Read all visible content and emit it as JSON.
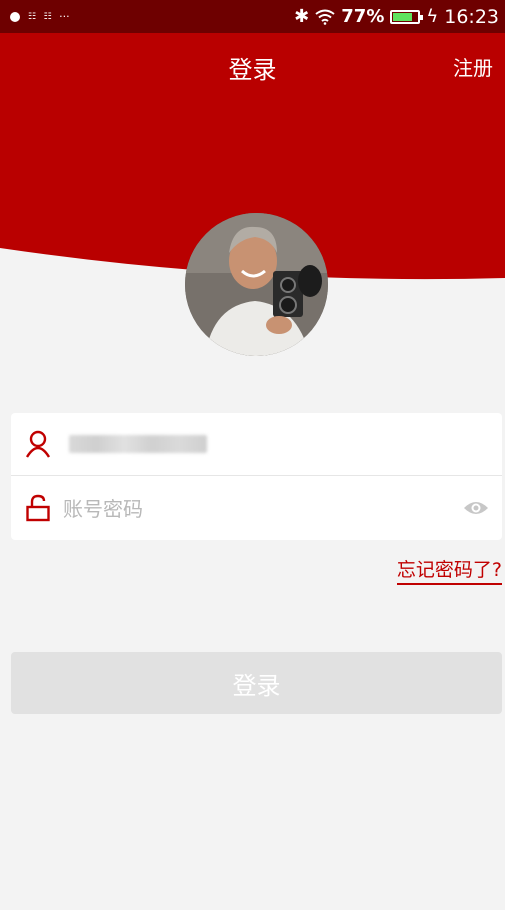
{
  "status_bar": {
    "dots": "···",
    "battery_percent": "77%",
    "battery_level": 0.77,
    "time": "16:23"
  },
  "nav": {
    "title": "登录",
    "register_label": "注册"
  },
  "form": {
    "username_value": "",
    "password_placeholder": "账号密码"
  },
  "forgot_password_label": "忘记密码了?",
  "login_button_label": "登录",
  "colors": {
    "primary_red": "#b90000",
    "statusbar": "#6e0000",
    "background": "#f3f3f3",
    "disabled_button": "#e1e1e1"
  }
}
